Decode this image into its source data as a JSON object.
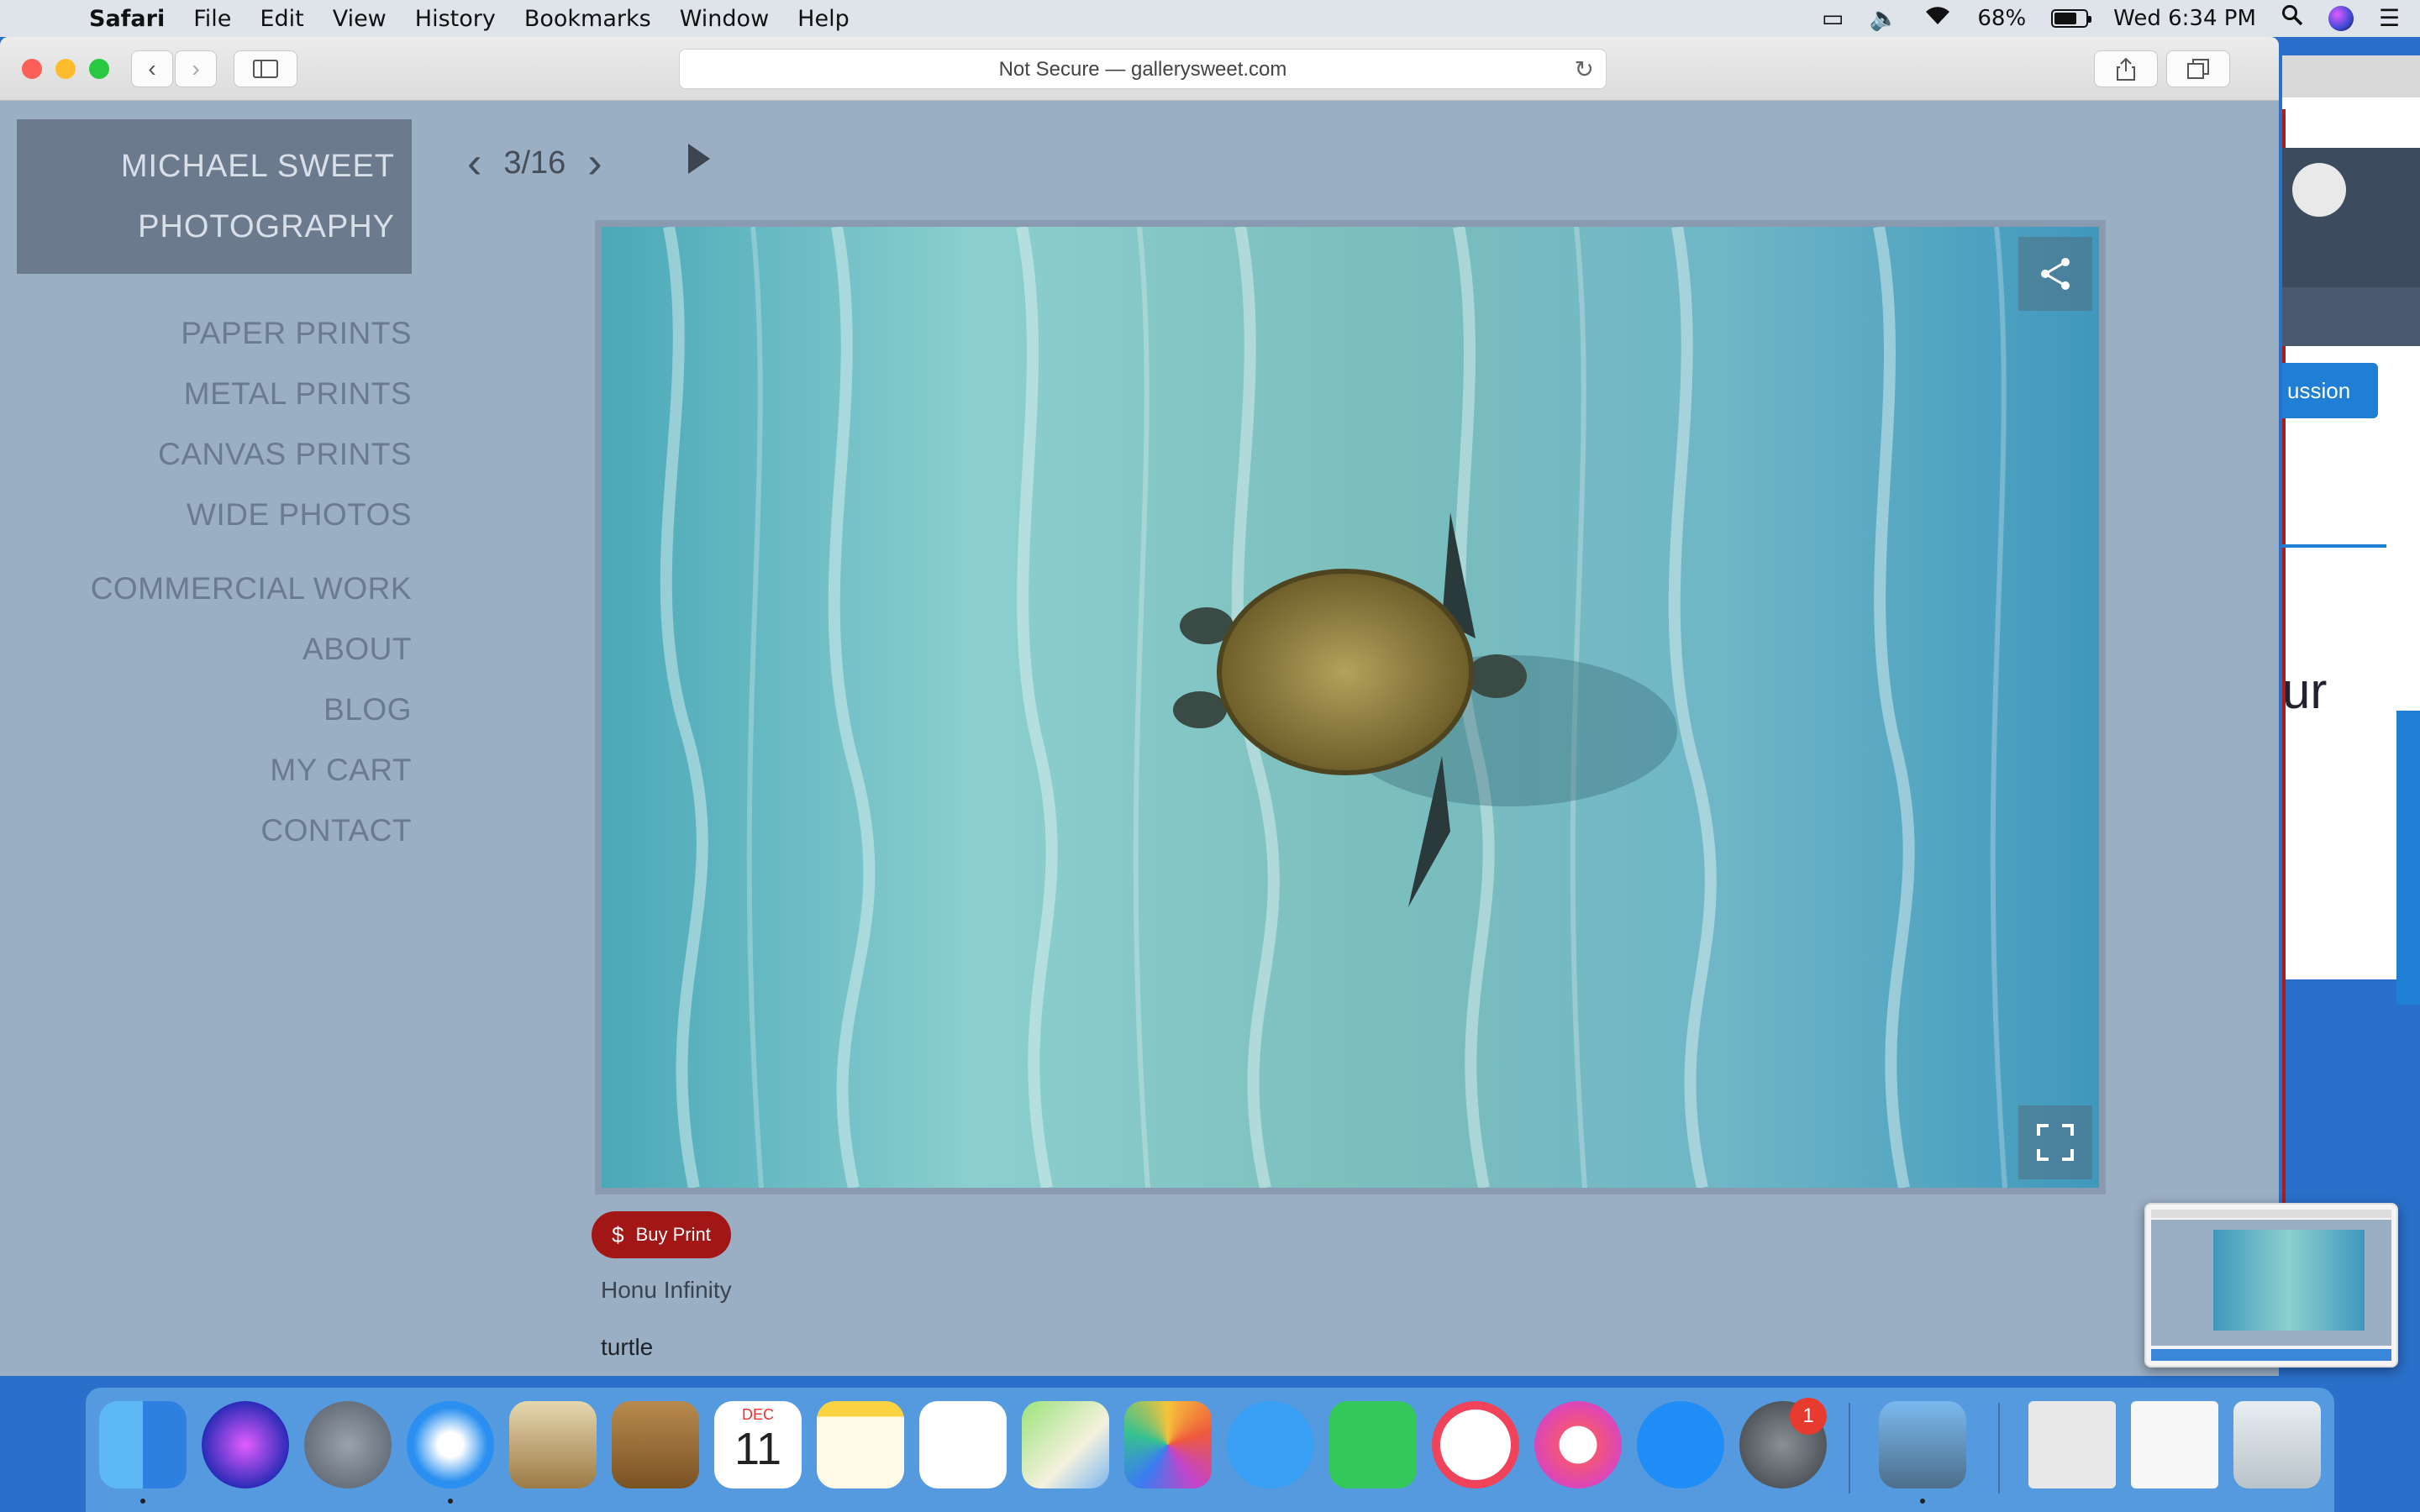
{
  "menubar": {
    "app_name": "Safari",
    "items": [
      "File",
      "Edit",
      "View",
      "History",
      "Bookmarks",
      "Window",
      "Help"
    ],
    "battery": "68%",
    "clock": "Wed 6:34 PM"
  },
  "browser": {
    "address_text": "Not Secure — gallerysweet.com"
  },
  "site": {
    "brand_line1": "MICHAEL SWEET",
    "brand_line2": "PHOTOGRAPHY",
    "nav": [
      "PAPER PRINTS",
      "METAL PRINTS",
      "CANVAS PRINTS",
      "WIDE PHOTOS",
      "COMMERCIAL WORK",
      "ABOUT",
      "BLOG",
      "MY CART",
      "CONTACT"
    ],
    "pager": "3/16",
    "buy_label": "Buy Print",
    "photo_title": "Honu Infinity",
    "photo_tag": "turtle"
  },
  "background_window": {
    "button_fragment": "ussion",
    "text_fragment": "ur"
  },
  "dock": {
    "calendar_month": "DEC",
    "calendar_day": "11",
    "badge_count": "1"
  },
  "colors": {
    "page_bg": "#9aaec4",
    "brand_box": "#6b7a8d",
    "nav_text": "#6a7a8f",
    "buy_button": "#a31616",
    "desktop": "#2a6fc9"
  }
}
